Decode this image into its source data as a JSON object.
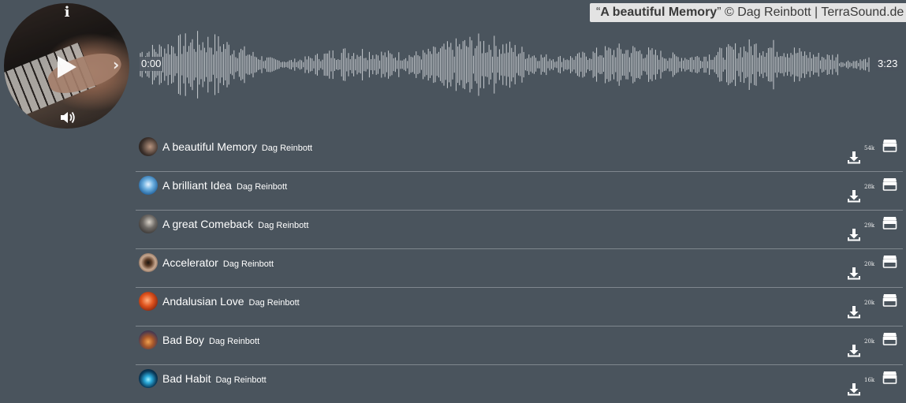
{
  "player": {
    "info_icon": "info-icon",
    "play_icon": "play-icon",
    "next_icon": "chevron-right-icon",
    "volume_icon": "volume-icon",
    "caption": {
      "open_quote": "“",
      "title": "A beautiful Memory",
      "rest": "” © Dag Reinbott | TerraSound.de"
    },
    "time_start": "0:00",
    "time_end": "3:23"
  },
  "tracks": [
    {
      "title": "A beautiful Memory",
      "artist": "Dag Reinbott",
      "count": "54k"
    },
    {
      "title": "A brilliant Idea",
      "artist": "Dag Reinbott",
      "count": "28k"
    },
    {
      "title": "A great Comeback",
      "artist": "Dag Reinbott",
      "count": "29k"
    },
    {
      "title": "Accelerator",
      "artist": "Dag Reinbott",
      "count": "20k"
    },
    {
      "title": "Andalusian Love",
      "artist": "Dag Reinbott",
      "count": "20k"
    },
    {
      "title": "Bad Boy",
      "artist": "Dag Reinbott",
      "count": "20k"
    },
    {
      "title": "Bad Habit",
      "artist": "Dag Reinbott",
      "count": "16k"
    }
  ],
  "icons": {
    "download": "download-icon",
    "cart": "cart-icon"
  },
  "colors": {
    "background": "#4a545d",
    "waveform": "#c9cdd1",
    "caption_bg": "#e3e3e3",
    "divider": "#7f878e"
  }
}
